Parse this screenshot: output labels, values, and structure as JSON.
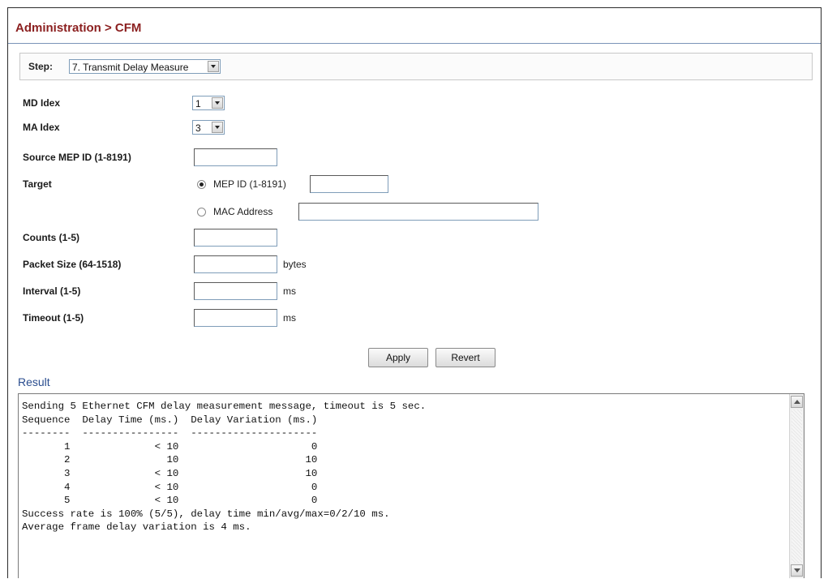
{
  "breadcrumb": "Administration > CFM",
  "step": {
    "label": "Step:",
    "selected": "7. Transmit Delay Measure"
  },
  "form": {
    "md_index": {
      "label": "MD Idex",
      "value": "1"
    },
    "ma_index": {
      "label": "MA Idex",
      "value": "3"
    },
    "source_mep": {
      "label": "Source MEP ID (1-8191)",
      "value": ""
    },
    "target": {
      "label": "Target",
      "option_mep": "MEP ID (1-8191)",
      "option_mac": "MAC Address",
      "selected": "mep"
    },
    "counts": {
      "label": "Counts (1-5)",
      "value": ""
    },
    "packet_size": {
      "label": "Packet Size (64-1518)",
      "value": "",
      "unit": "bytes"
    },
    "interval": {
      "label": "Interval (1-5)",
      "value": "",
      "unit": "ms"
    },
    "timeout": {
      "label": "Timeout (1-5)",
      "value": "",
      "unit": "ms"
    }
  },
  "buttons": {
    "apply": "Apply",
    "revert": "Revert"
  },
  "result": {
    "title": "Result",
    "text": "Sending 5 Ethernet CFM delay measurement message, timeout is 5 sec.\nSequence  Delay Time (ms.)  Delay Variation (ms.)\n--------  ----------------  ---------------------\n       1              < 10                      0\n       2                10                     10\n       3              < 10                     10\n       4              < 10                      0\n       5              < 10                      0\nSuccess rate is 100% (5/5), delay time min/avg/max=0/2/10 ms.\nAverage frame delay variation is 4 ms."
  }
}
